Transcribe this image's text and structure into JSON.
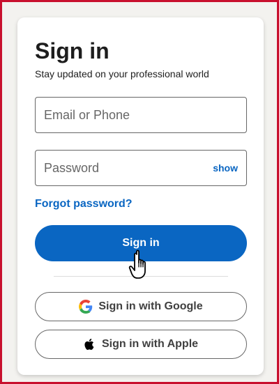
{
  "signin": {
    "title": "Sign in",
    "subtitle": "Stay updated on your professional world",
    "email_placeholder": "Email or Phone",
    "password_placeholder": "Password",
    "show_label": "show",
    "forgot_label": "Forgot password?",
    "submit_label": "Sign in",
    "google_label": "Sign in with Google",
    "apple_label": "Sign in with Apple"
  },
  "colors": {
    "accent": "#0a66c2",
    "frame_border": "#c8102e"
  },
  "icons": {
    "google": "google-g-icon",
    "apple": "apple-logo-icon",
    "cursor": "hand-pointer-icon"
  }
}
